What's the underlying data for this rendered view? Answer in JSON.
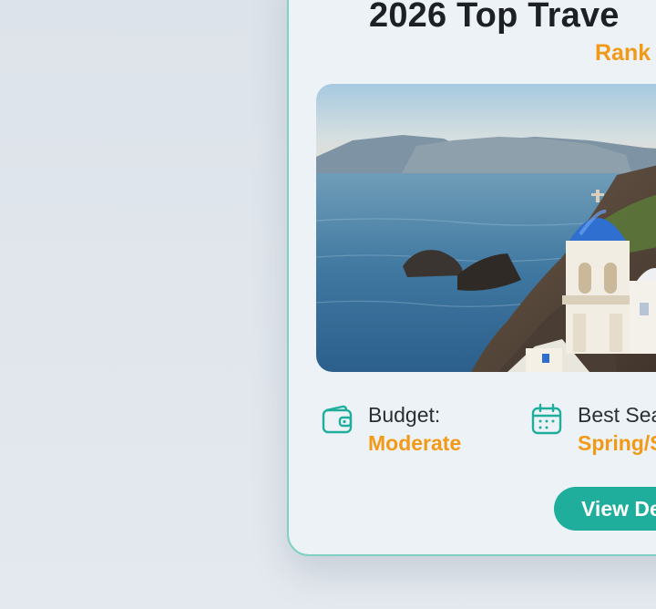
{
  "card": {
    "title": "2026 Top Trave",
    "rank": "Rank",
    "photo_alt": "Coastal village with blue-domed church overlooking the sea",
    "budget": {
      "label": "Budget:",
      "value": "Moderate",
      "icon": "wallet-icon"
    },
    "season": {
      "label": "Best Sea",
      "value": "Spring/S",
      "icon": "calendar-icon"
    },
    "details_button": "View De"
  },
  "colors": {
    "accent_teal": "#1fae9c",
    "accent_orange": "#f29a17",
    "card_border": "#7fd1c4",
    "background": "#dfe5ec"
  }
}
